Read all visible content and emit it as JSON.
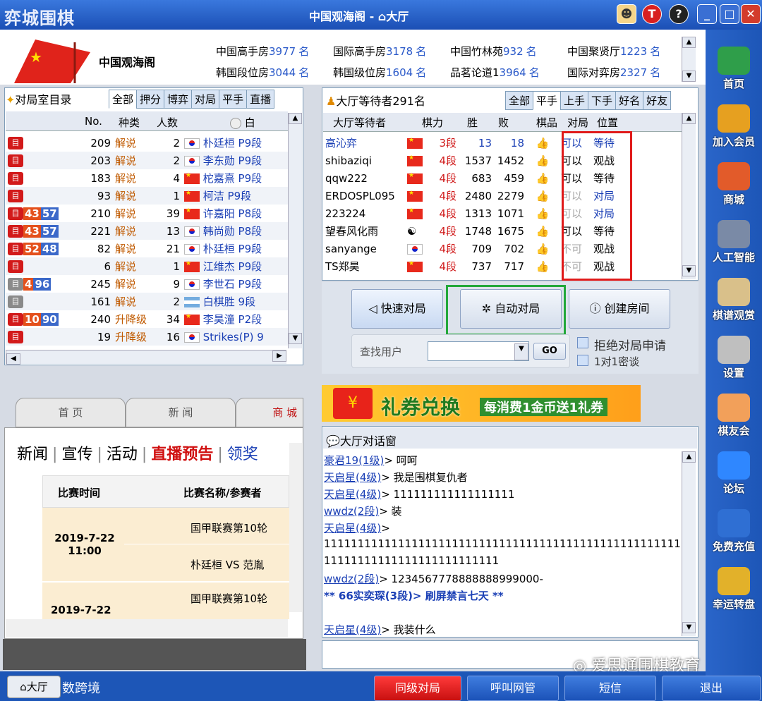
{
  "window": {
    "logo": "弈城围棋",
    "title": "中国观海阁 - ",
    "lobby": "大厅"
  },
  "room": {
    "name": "中国观海阁",
    "stats": [
      {
        "name": "中国高手房",
        "count": "3977",
        "unit": "名"
      },
      {
        "name": "国际高手房",
        "count": "3178",
        "unit": "名"
      },
      {
        "name": "中国竹林苑",
        "count": "932",
        "unit": "名"
      },
      {
        "name": "中国聚贤厅",
        "count": "1223",
        "unit": "名"
      },
      {
        "name": "韩国段位房",
        "count": "3044",
        "unit": "名"
      },
      {
        "name": "韩国级位房",
        "count": "1604",
        "unit": "名"
      },
      {
        "name": "品茗论道1",
        "count": "3964",
        "unit": "名"
      },
      {
        "name": "国际对弈房",
        "count": "2327",
        "unit": "名"
      }
    ]
  },
  "left": {
    "title": "对局室目录",
    "tabs": [
      "全部",
      "押分",
      "博弈",
      "对局",
      "平手",
      "直播"
    ],
    "headers": [
      "No.",
      "种类",
      "人数",
      "白"
    ],
    "rows": [
      {
        "c1": "",
        "c2": "",
        "no": "209",
        "type": "解说",
        "num": "2",
        "flag": "kr",
        "name": "朴廷桓 P9段"
      },
      {
        "c1": "",
        "c2": "",
        "no": "203",
        "type": "解说",
        "num": "2",
        "flag": "kr",
        "name": "李东勋 P9段"
      },
      {
        "c1": "",
        "c2": "",
        "no": "183",
        "type": "解说",
        "num": "4",
        "flag": "cn",
        "name": "柁嘉熹 P9段"
      },
      {
        "c1": "",
        "c2": "",
        "no": "93",
        "type": "解说",
        "num": "1",
        "flag": "cn",
        "name": "柯洁 P9段"
      },
      {
        "c1": "43",
        "c2": "57",
        "no": "210",
        "type": "解说",
        "num": "39",
        "flag": "cn",
        "name": "许嘉阳 P8段"
      },
      {
        "c1": "43",
        "c2": "57",
        "no": "221",
        "type": "解说",
        "num": "13",
        "flag": "kr",
        "name": "韩尚勋 P8段"
      },
      {
        "c1": "52",
        "c2": "48",
        "no": "82",
        "type": "解说",
        "num": "21",
        "flag": "kr",
        "name": "朴廷桓 P9段"
      },
      {
        "c1": "",
        "c2": "",
        "no": "6",
        "type": "解说",
        "num": "1",
        "flag": "cn",
        "name": "江维杰 P9段"
      },
      {
        "c1": "4",
        "c2": "96",
        "no": "245",
        "type": "解说",
        "num": "9",
        "flag": "kr",
        "name": "李世石 P9段"
      },
      {
        "c1": "",
        "c2": "",
        "no": "161",
        "type": "解说",
        "num": "2",
        "flag": "ar",
        "name": "白棋胜 9段"
      },
      {
        "c1": "10",
        "c2": "90",
        "no": "240",
        "type": "升降级",
        "num": "34",
        "flag": "cn",
        "name": "李昊潼 P2段"
      },
      {
        "c1": "",
        "c2": "",
        "no": "19",
        "type": "升降级",
        "num": "16",
        "flag": "kr",
        "name": "Strikes(P) 9"
      }
    ]
  },
  "news": {
    "tabs": [
      "首 页",
      "新 闻",
      "商 城"
    ],
    "subtabs": [
      "新闻",
      "宣传",
      "活动",
      "直播预告",
      "领奖"
    ],
    "col_time": "比赛时间",
    "col_name": "比赛名称/参赛者",
    "rows": [
      {
        "time": "2019-7-22\n11:00",
        "event": "国甲联赛第10轮",
        "players": "朴廷桓 VS 范胤"
      },
      {
        "time": "2019-7-22",
        "event": "国甲联赛第10轮",
        "players": ""
      }
    ]
  },
  "waiting": {
    "title": "大厅等待者291名",
    "tabs": [
      "全部",
      "平手",
      "上手",
      "下手",
      "好名",
      "好友"
    ],
    "headers": [
      "大厅等待者",
      "棋力",
      "胜",
      "败",
      "棋品",
      "对局",
      "位置"
    ],
    "rows": [
      {
        "name": "高沁弈",
        "flag": "cn",
        "rank": "3段",
        "win": "13",
        "loss": "18",
        "ok": "可以",
        "pos": "等待"
      },
      {
        "name": "shibaziqi",
        "flag": "cn",
        "rank": "4段",
        "win": "1537",
        "loss": "1452",
        "ok": "可以",
        "pos": "观战"
      },
      {
        "name": "qqw222",
        "flag": "cn",
        "rank": "4段",
        "win": "683",
        "loss": "459",
        "ok": "可以",
        "pos": "等待"
      },
      {
        "name": "ERDOSPL095",
        "flag": "cn",
        "rank": "4段",
        "win": "2480",
        "loss": "2279",
        "ok": "可以",
        "pos": "对局"
      },
      {
        "name": "223224",
        "flag": "cn",
        "rank": "4段",
        "win": "1313",
        "loss": "1071",
        "ok": "可以",
        "pos": "对局"
      },
      {
        "name": "望春风化雨",
        "flag": "yy",
        "rank": "4段",
        "win": "1748",
        "loss": "1675",
        "ok": "可以",
        "pos": "等待"
      },
      {
        "name": "sanyange",
        "flag": "kr",
        "rank": "4段",
        "win": "709",
        "loss": "702",
        "ok": "不可",
        "pos": "观战"
      },
      {
        "name": "TS郑昊",
        "flag": "cn",
        "rank": "4段",
        "win": "737",
        "loss": "717",
        "ok": "不可",
        "pos": "观战"
      }
    ]
  },
  "actions": {
    "quick": "快速对局",
    "auto": "自动对局",
    "create": "创建房间",
    "find_label": "查找用户",
    "go": "GO",
    "reject": "拒绝对局申请",
    "secret": "1对1密谈"
  },
  "banner": {
    "main": "礼券兑换",
    "sub": "每消费1金币送1礼券"
  },
  "chat": {
    "title": "大厅对话窗",
    "lines": [
      {
        "user": "豪君19(1级)",
        "msg": "> 呵呵"
      },
      {
        "user": "天启星(4级)",
        "msg": "> 我是围棋复仇者"
      },
      {
        "user": "天启星(4级)",
        "msg": "> 111111111111111111"
      },
      {
        "user": "wwdz(2段)",
        "msg": "> 装"
      },
      {
        "user": "天启星(4级)",
        "msg": ">"
      },
      {
        "user": "",
        "msg": "1111111111111111111111111111111111111111111111111111111111"
      },
      {
        "user": "",
        "msg": "11111111111111111111111111"
      },
      {
        "user": "wwdz(2段)",
        "msg": "> 1234567778888888999000-"
      },
      {
        "user": "",
        "msg": "** 66实奕琛(3段)> 刷屏禁言七天 **"
      },
      {
        "user": "",
        "msg": ""
      },
      {
        "user": "天启星(4级)",
        "msg": "> 我装什么"
      }
    ]
  },
  "watermark": "爱思通围棋教育",
  "bottom": {
    "lobby_tab": "大厅",
    "left_text": "数跨境",
    "btns": [
      "同级对局",
      "呼叫网管",
      "短信",
      "退出"
    ]
  },
  "sidebar": [
    "首页",
    "加入会员",
    "商城",
    "人工智能",
    "棋谱观赏",
    "设置",
    "棋友会",
    "论坛",
    "免费充值",
    "幸运转盘"
  ],
  "colors": {
    "accent": "#1d56b7",
    "red_highlight": "#e01a1a",
    "green_highlight": "#23a83a"
  }
}
